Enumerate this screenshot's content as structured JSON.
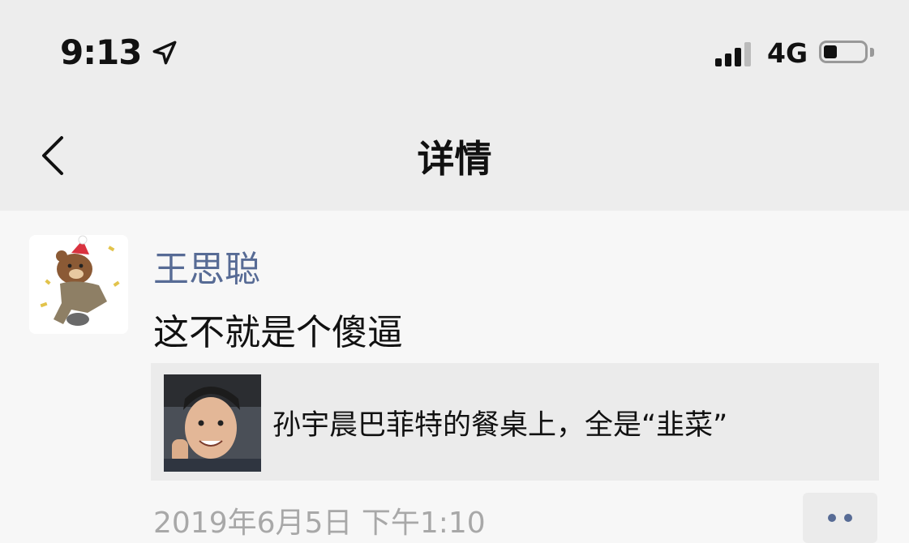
{
  "status_bar": {
    "time": "9:13",
    "location_icon": "location-arrow-icon",
    "signal_icon": "cellular-signal-icon",
    "network": "4G",
    "battery_icon": "battery-icon"
  },
  "nav": {
    "back_icon": "chevron-left-icon",
    "title": "详情"
  },
  "post": {
    "avatar": "avatar",
    "username": "王思聪",
    "message": "这不就是个傻逼",
    "link": {
      "title": "孙宇晨巴菲特的餐桌上，全是“韭菜”",
      "thumbnail": "thumbnail-image"
    },
    "timestamp": "2019年6月5日  下午1:10",
    "more_icon": "more-dots-icon"
  },
  "colors": {
    "background": "#ededed",
    "content_background": "#f7f7f7",
    "name_link": "#576b95",
    "timestamp": "#a8a8a8",
    "card_background": "#ebebeb"
  }
}
